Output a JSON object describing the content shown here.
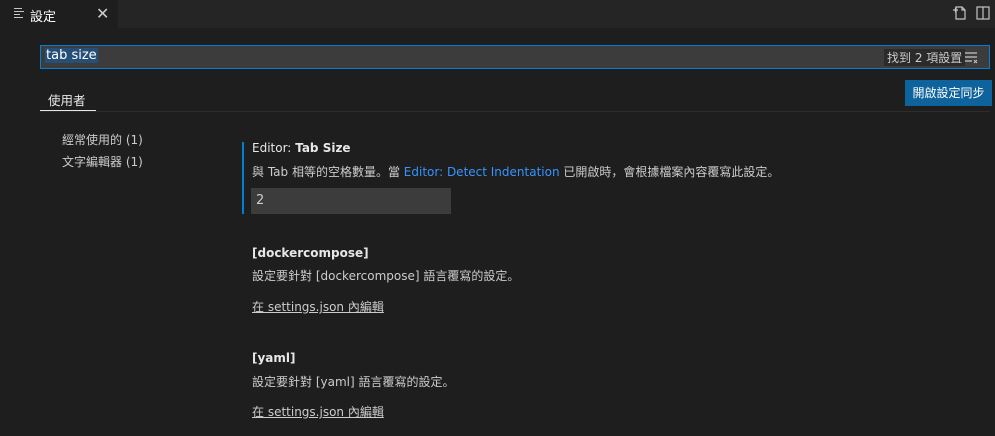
{
  "tab": {
    "title": "設定",
    "close_glyph": "✕"
  },
  "search": {
    "value": "tab size",
    "result_count": "找到 2 項設置"
  },
  "scope": {
    "user_tab": "使用者",
    "sync_button": "開啟設定同步"
  },
  "toc": {
    "items": [
      {
        "label": "經常使用的 (1)"
      },
      {
        "label": "文字編輯器 (1)"
      }
    ]
  },
  "settings": {
    "tab_size": {
      "category": "Editor:",
      "name": "Tab Size",
      "desc_before": "與 Tab 相等的空格數量。當",
      "desc_link": "Editor: Detect Indentation",
      "desc_after": "已開啟時，會根據檔案內容覆寫此設定。",
      "value": "2"
    },
    "dockercompose": {
      "title": "[dockercompose]",
      "desc": "設定要針對 [dockercompose] 語言覆寫的設定。",
      "link": "在 settings.json 內編輯"
    },
    "yaml": {
      "title": "[yaml]",
      "desc": "設定要針對 [yaml] 語言覆寫的設定。",
      "link": "在 settings.json 內編輯"
    }
  },
  "icons": {
    "tab": "settings-editor-icon",
    "open_json": "open-settings-json-icon",
    "split": "split-editor-icon",
    "filter": "filter-icon"
  },
  "colors": {
    "accent": "#007fd4",
    "button": "#0e639c",
    "link": "#3794ff",
    "background": "#1e1e1e"
  }
}
